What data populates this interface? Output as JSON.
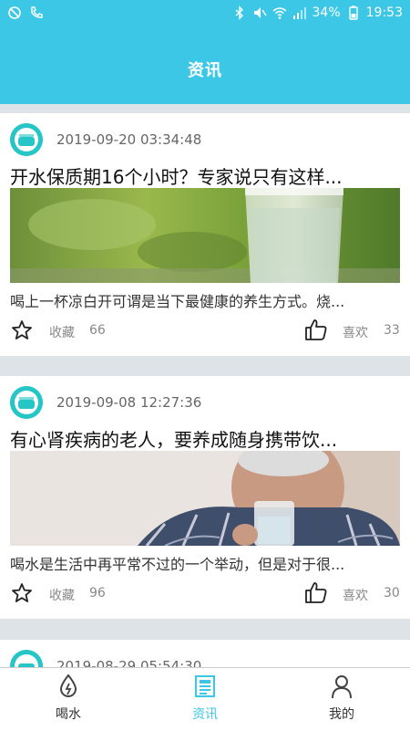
{
  "status_bar": {
    "battery": "34%",
    "time": "19:53"
  },
  "header": {
    "title": "资讯"
  },
  "feed": [
    {
      "date": "2019-09-20 03:34:48",
      "headline": "开水保质期16个小时？专家说只有这样...",
      "summary": "喝上一杯凉白开可谓是当下最健康的养生方式。烧...",
      "favorite_label": "收藏",
      "favorite_count": "66",
      "like_label": "喜欢",
      "like_count": "33"
    },
    {
      "date": "2019-09-08 12:27:36",
      "headline": "有心肾疾病的老人，要养成随身携带饮...",
      "summary": "喝水是生活中再平常不过的一个举动，但是对于很...",
      "favorite_label": "收藏",
      "favorite_count": "96",
      "like_label": "喜欢",
      "like_count": "30"
    },
    {
      "date": "2019-08-29 05:54:30"
    }
  ],
  "tabs": [
    {
      "label": "喝水",
      "icon": "water-drop-icon",
      "active": false
    },
    {
      "label": "资讯",
      "icon": "news-icon",
      "active": true
    },
    {
      "label": "我的",
      "icon": "person-icon",
      "active": false
    }
  ],
  "colors": {
    "accent": "#3cc7e6",
    "avatar": "#27c6c6"
  }
}
